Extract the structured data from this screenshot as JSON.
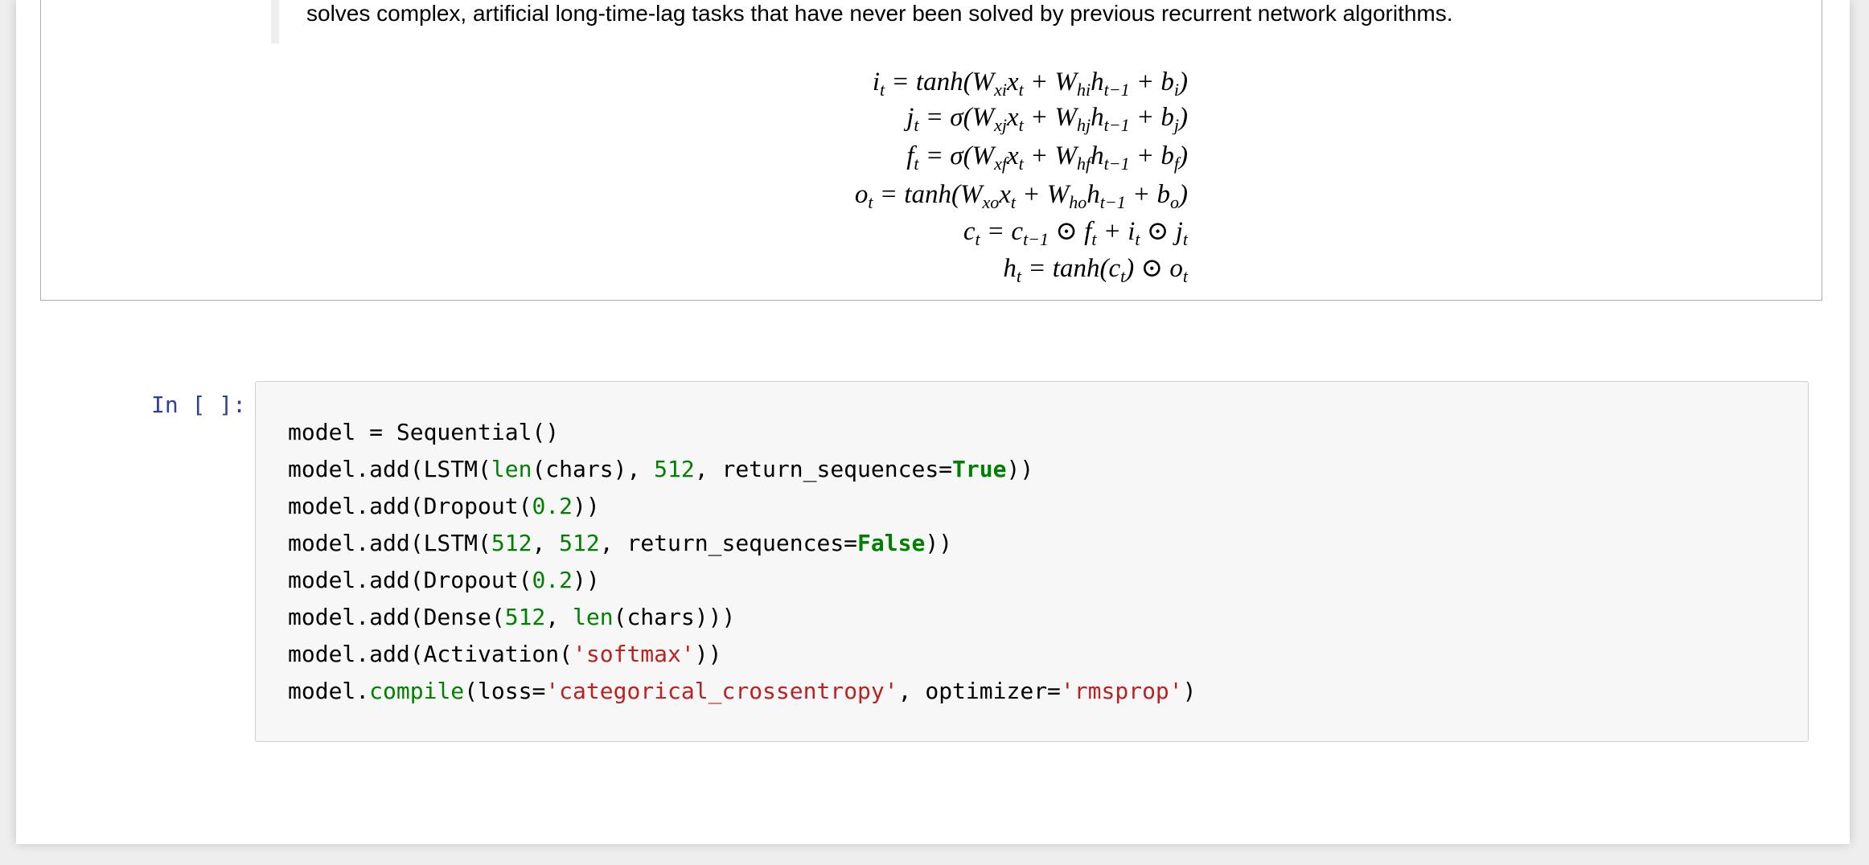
{
  "markdown_cell": {
    "quote_text": "solves complex, artificial long-time-lag tasks that have never been solved by previous recurrent network algorithms.",
    "equations": [
      {
        "lhs": "i",
        "lhs_sub": "t",
        "parts": [
          [
            "t",
            "= tanh(W"
          ],
          [
            "s",
            "xi"
          ],
          [
            "t",
            "x"
          ],
          [
            "s",
            "t"
          ],
          [
            "t",
            " + W"
          ],
          [
            "s",
            "hi"
          ],
          [
            "t",
            "h"
          ],
          [
            "s",
            "t−1"
          ],
          [
            "t",
            " + b"
          ],
          [
            "s",
            "i"
          ],
          [
            "t",
            ")"
          ]
        ]
      },
      {
        "lhs": "j",
        "lhs_sub": "t",
        "parts": [
          [
            "t",
            "= σ(W"
          ],
          [
            "s",
            "xj"
          ],
          [
            "t",
            "x"
          ],
          [
            "s",
            "t"
          ],
          [
            "t",
            " + W"
          ],
          [
            "s",
            "hj"
          ],
          [
            "t",
            "h"
          ],
          [
            "s",
            "t−1"
          ],
          [
            "t",
            " + b"
          ],
          [
            "s",
            "j"
          ],
          [
            "t",
            ")"
          ]
        ]
      },
      {
        "lhs": "f",
        "lhs_sub": "t",
        "parts": [
          [
            "t",
            "= σ(W"
          ],
          [
            "s",
            "xf"
          ],
          [
            "t",
            "x"
          ],
          [
            "s",
            "t"
          ],
          [
            "t",
            " + W"
          ],
          [
            "s",
            "hf"
          ],
          [
            "t",
            "h"
          ],
          [
            "s",
            "t−1"
          ],
          [
            "t",
            " + b"
          ],
          [
            "s",
            "f"
          ],
          [
            "t",
            ")"
          ]
        ]
      },
      {
        "lhs": "o",
        "lhs_sub": "t",
        "parts": [
          [
            "t",
            "= tanh(W"
          ],
          [
            "s",
            "xo"
          ],
          [
            "t",
            "x"
          ],
          [
            "s",
            "t"
          ],
          [
            "t",
            " + W"
          ],
          [
            "s",
            "ho"
          ],
          [
            "t",
            "h"
          ],
          [
            "s",
            "t−1"
          ],
          [
            "t",
            " + b"
          ],
          [
            "s",
            "o"
          ],
          [
            "t",
            ")"
          ]
        ]
      },
      {
        "lhs": "c",
        "lhs_sub": "t",
        "parts": [
          [
            "t",
            "= c"
          ],
          [
            "s",
            "t−1"
          ],
          [
            "t",
            " ⊙ f"
          ],
          [
            "s",
            "t"
          ],
          [
            "t",
            " + i"
          ],
          [
            "s",
            "t"
          ],
          [
            "t",
            " ⊙ j"
          ],
          [
            "s",
            "t"
          ]
        ]
      },
      {
        "lhs": "h",
        "lhs_sub": "t",
        "parts": [
          [
            "t",
            "= tanh(c"
          ],
          [
            "s",
            "t"
          ],
          [
            "t",
            ") ⊙ o"
          ],
          [
            "s",
            "t"
          ]
        ]
      }
    ]
  },
  "code_cell": {
    "prompt": "In [ ]:",
    "lines": [
      [
        [
          "p",
          "model = Sequential()"
        ]
      ],
      [
        [
          "p",
          "model.add(LSTM("
        ],
        [
          "b",
          "len"
        ],
        [
          "p",
          "(chars), "
        ],
        [
          "n",
          "512"
        ],
        [
          "p",
          ", return_sequences="
        ],
        [
          "k",
          "True"
        ],
        [
          "p",
          "))"
        ]
      ],
      [
        [
          "p",
          "model.add(Dropout("
        ],
        [
          "n",
          "0.2"
        ],
        [
          "p",
          "))"
        ]
      ],
      [
        [
          "p",
          "model.add(LSTM("
        ],
        [
          "n",
          "512"
        ],
        [
          "p",
          ", "
        ],
        [
          "n",
          "512"
        ],
        [
          "p",
          ", return_sequences="
        ],
        [
          "k",
          "False"
        ],
        [
          "p",
          "))"
        ]
      ],
      [
        [
          "p",
          "model.add(Dropout("
        ],
        [
          "n",
          "0.2"
        ],
        [
          "p",
          "))"
        ]
      ],
      [
        [
          "p",
          "model.add(Dense("
        ],
        [
          "n",
          "512"
        ],
        [
          "p",
          ", "
        ],
        [
          "b",
          "len"
        ],
        [
          "p",
          "(chars)))"
        ]
      ],
      [
        [
          "p",
          "model.add(Activation("
        ],
        [
          "s",
          "'softmax'"
        ],
        [
          "p",
          "))"
        ]
      ],
      [
        [
          "p",
          "model."
        ],
        [
          "b",
          "compile"
        ],
        [
          "p",
          "(loss="
        ],
        [
          "s",
          "'categorical_crossentropy'"
        ],
        [
          "p",
          ", optimizer="
        ],
        [
          "s",
          "'rmsprop'"
        ],
        [
          "p",
          ")"
        ]
      ]
    ]
  }
}
